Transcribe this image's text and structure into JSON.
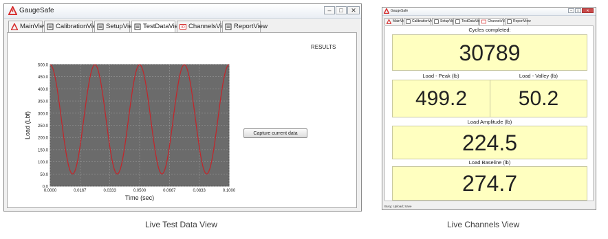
{
  "left_window": {
    "app_title": "GaugeSafe",
    "tabs": [
      {
        "label": "MainView",
        "icon": "warning-triangle-icon",
        "active": false
      },
      {
        "label": "CalibrationView",
        "icon": "sheet-icon",
        "active": false
      },
      {
        "label": "SetupView",
        "icon": "sheet-icon",
        "active": false
      },
      {
        "label": "TestDataView",
        "icon": "sheet-icon",
        "active": true
      },
      {
        "label": "ChannelsView",
        "icon": "io-icon",
        "active": false
      },
      {
        "label": "ReportView",
        "icon": "sheet-icon",
        "active": false
      }
    ],
    "results_label": "RESULTS",
    "capture_button": "Capture current data",
    "caption": "Live Test Data View"
  },
  "chart_data": {
    "type": "line",
    "xlabel": "Time (sec)",
    "ylabel": "Load (Lbf)",
    "xlim": [
      0,
      0.1
    ],
    "ylim": [
      0,
      500
    ],
    "x_ticks": [
      "0.0000",
      "0.0167",
      "0.0333",
      "0.0500",
      "0.0667",
      "0.0833",
      "0.1000"
    ],
    "y_ticks": [
      "0.0",
      "50.0",
      "100.0",
      "150.0",
      "200.0",
      "250.0",
      "300.0",
      "350.0",
      "400.0",
      "450.0",
      "500.0"
    ],
    "grid": true,
    "series": [
      {
        "color": "#c0282d",
        "baseline": 274.7,
        "amplitude": 224.5,
        "cycles": 4,
        "x": [
          0.0,
          0.0125,
          0.025,
          0.0375,
          0.05,
          0.0625,
          0.075,
          0.0875,
          0.1
        ],
        "y": [
          499.2,
          50.2,
          499.2,
          50.2,
          499.2,
          50.2,
          499.2,
          50.2,
          499.2
        ]
      }
    ],
    "plot_bg": "#6b6b6b"
  },
  "right_window": {
    "app_title": "GaugeSafe",
    "tabs": [
      "MainView",
      "CalibrationView",
      "SetupView",
      "TestDataView",
      "ChannelsView",
      "ReportView"
    ],
    "cycles_label": "Cycles completed:",
    "cycles_value": "30789",
    "peak_label": "Load - Peak (lb)",
    "peak_value": "499.2",
    "valley_label": "Load - Valley (lb)",
    "valley_value": "50.2",
    "amplitude_label": "Load Amplitude (lb)",
    "amplitude_value": "224.5",
    "baseline_label": "Load Baseline (lb)",
    "baseline_value": "274.7",
    "status_text": "Busy; Upload; Save",
    "caption": "Live Channels View"
  },
  "colors": {
    "value_box": "#ffffc0",
    "curve": "#c0282d",
    "plot_bg": "#6b6b6b",
    "brand_red": "#d62b2b"
  }
}
